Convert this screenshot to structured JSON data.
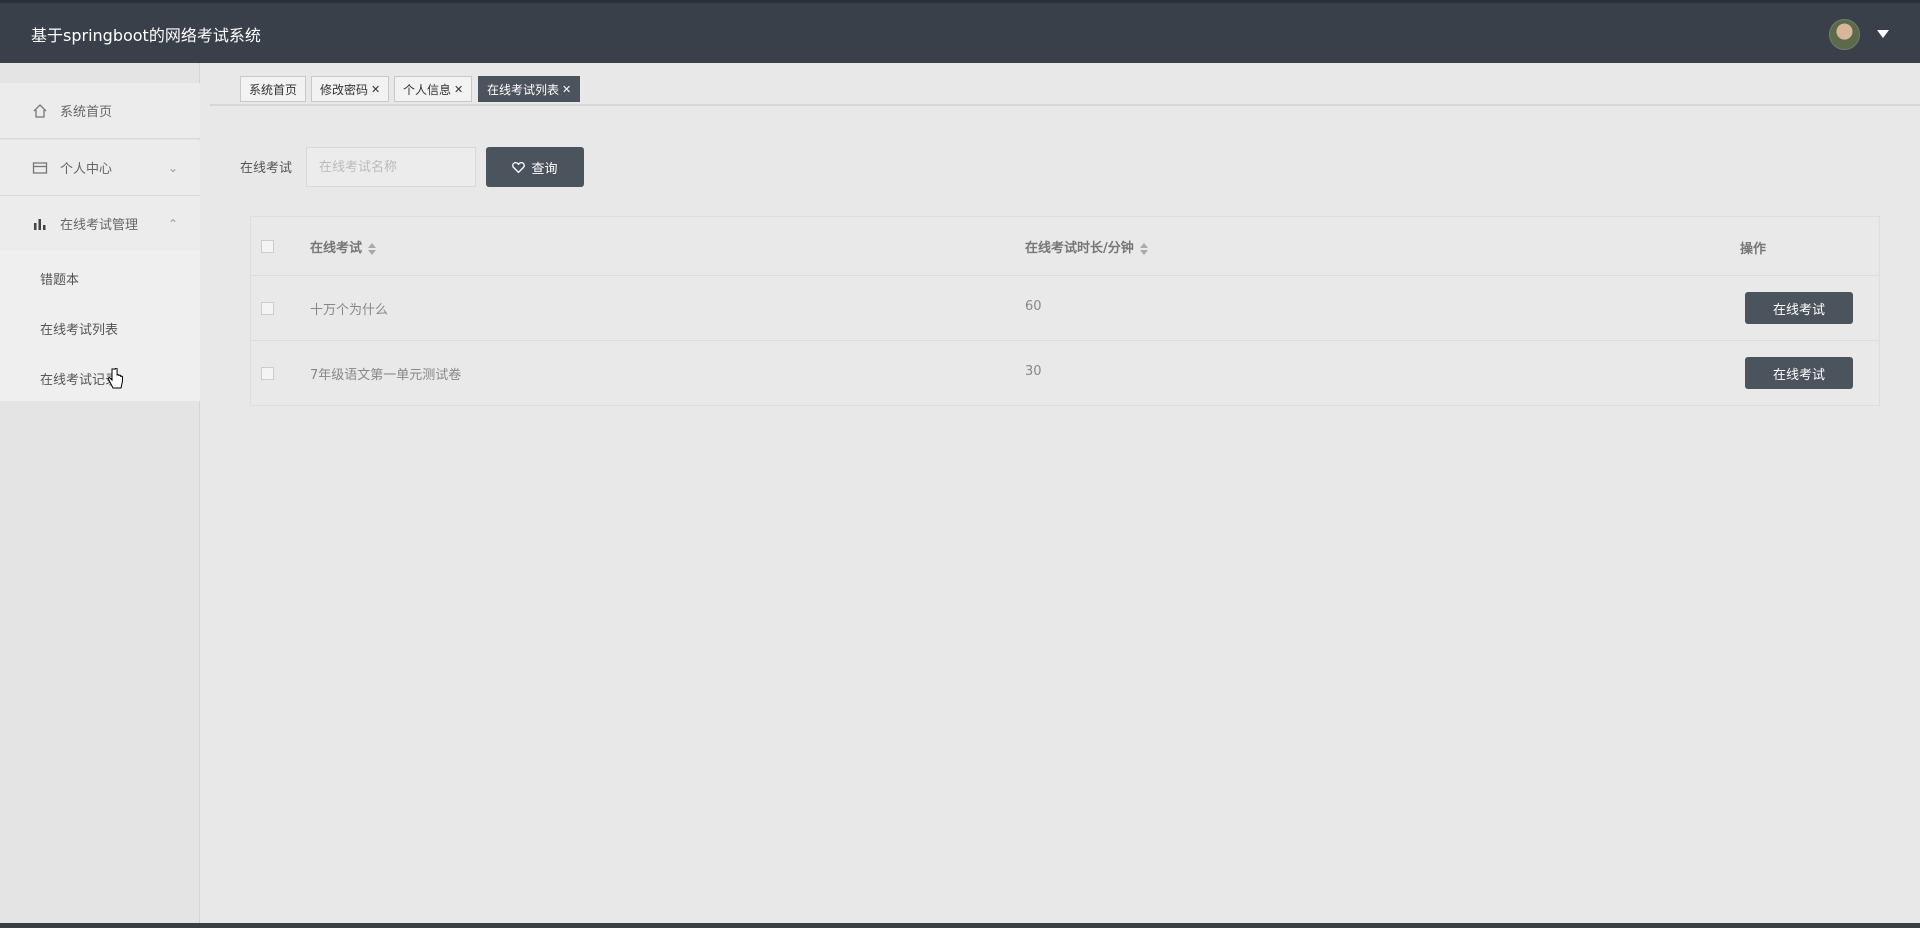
{
  "header": {
    "title": "基于springboot的网络考试系统"
  },
  "sidebar": {
    "items": [
      {
        "label": "系统首页",
        "icon": "home-icon"
      },
      {
        "label": "个人中心",
        "icon": "card-icon"
      },
      {
        "label": "在线考试管理",
        "icon": "bar-chart-icon"
      }
    ],
    "submenu": [
      {
        "label": "错题本"
      },
      {
        "label": "在线考试列表"
      },
      {
        "label": "在线考试记录"
      }
    ]
  },
  "tabs": [
    {
      "label": "系统首页",
      "closable": false,
      "active": false
    },
    {
      "label": "修改密码",
      "closable": true,
      "active": false
    },
    {
      "label": "个人信息",
      "closable": true,
      "active": false
    },
    {
      "label": "在线考试列表",
      "closable": true,
      "active": true
    }
  ],
  "search": {
    "label": "在线考试",
    "placeholder": "在线考试名称",
    "value": "",
    "button_label": "查询"
  },
  "table": {
    "columns": [
      "在线考试",
      "在线考试时长/分钟",
      "操作"
    ],
    "rows": [
      {
        "name": "十万个为什么",
        "duration": "60",
        "action": "在线考试"
      },
      {
        "name": "7年级语文第一单元测试卷",
        "duration": "30",
        "action": "在线考试"
      }
    ]
  },
  "colors": {
    "topbar": "#394049",
    "accent": "#4b535c"
  }
}
